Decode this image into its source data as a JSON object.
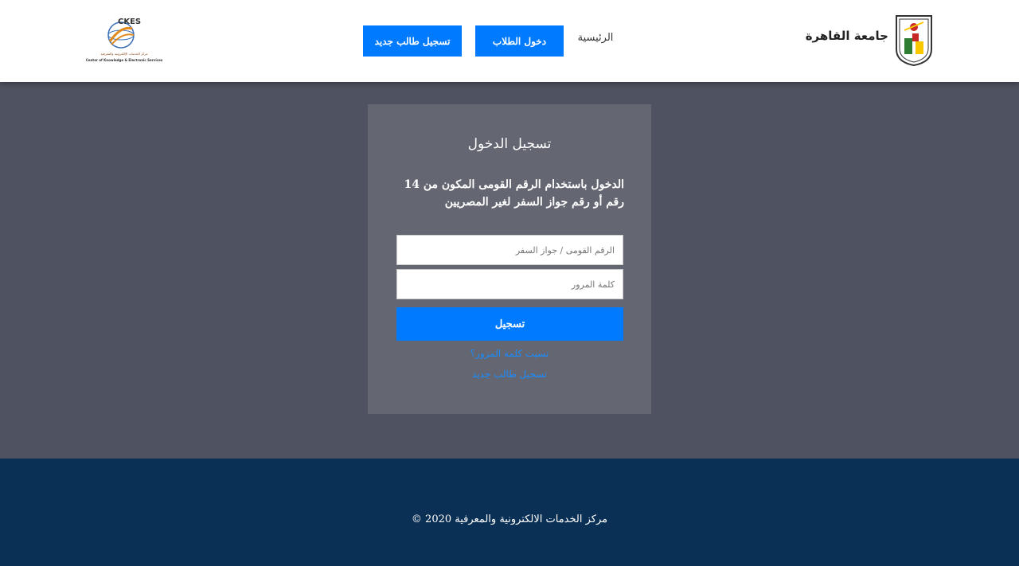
{
  "header": {
    "university_name": "جامعة القاهرة",
    "nav": {
      "home": "الرئيسية",
      "student_login": "دخول الطلاب",
      "register_new": "تسجيل طالب جديد"
    },
    "ckes_logo": {
      "acronym": "CKES",
      "arabic_name": "مركز الخدمات الإلكترونية والمعرفية",
      "english_name": "Center of Knowledge & Electronic Services"
    }
  },
  "login": {
    "title": "تسجيل الدخول",
    "description": "الدخول باستخدام الرقم القومى المكون من 14 رقم أو رقم جواز السفر لغير المصريين",
    "id_placeholder": "الرقم القومى / جواز السفر",
    "password_placeholder": "كلمة المرور",
    "submit_label": "تسجيل",
    "forgot_password": "نسيت كلمة المرور؟",
    "register_link": "تسجيل طالب جديد"
  },
  "footer": {
    "copyright": "مركز الخدمات الالكترونية والمعرفية 2020 ©"
  },
  "colors": {
    "primary": "#007bff",
    "background": "#4f5260",
    "card": "#646772",
    "footer": "#0b3055"
  }
}
